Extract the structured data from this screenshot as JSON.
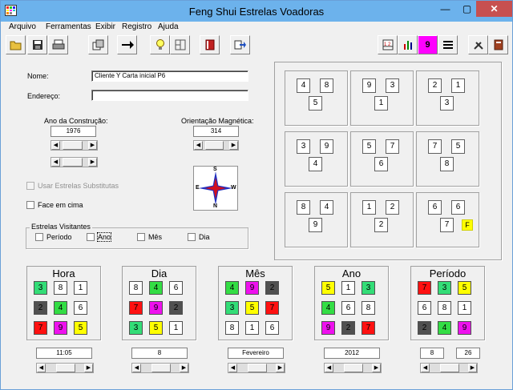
{
  "window": {
    "title": "Feng Shui Estrelas Voadoras",
    "minimize": "—",
    "maximize": "▢",
    "close": "✕"
  },
  "menu": [
    {
      "label": "Arquivo"
    },
    {
      "label": "Ferramentas"
    },
    {
      "label": "Exibir"
    },
    {
      "label": "Registro"
    },
    {
      "label": "Ajuda"
    }
  ],
  "toolbar": {
    "open": "open-folder-icon",
    "save": "save-disk-icon",
    "print": "printer-icon",
    "copy": "copy-icon",
    "next": "right-arrow-icon",
    "idea": "lightbulb-icon",
    "layout": "layout-icon",
    "book": "book-icon",
    "export": "export-icon",
    "right_tools": [
      "grid-numbers-icon",
      "bars-icon",
      "nine-icon",
      "lines-icon",
      "tools-icon",
      "manual-icon"
    ]
  },
  "form": {
    "nome_label": "Nome:",
    "nome_value": "Cliente Y  Carta inicial P6",
    "endereco_label": "Endereço:",
    "endereco_value": "",
    "ano_label": "Ano da Construção:",
    "ano_value": "1976",
    "orientacao_label": "Orientação Magnética:",
    "orientacao_value": "314",
    "usar_substitutas": "Usar Estrelas Substitutas",
    "face_em_cima": "Face em cima",
    "visitantes_title": "Estrelas Visitantes",
    "visitantes": [
      "Período",
      "Ano",
      "Mês",
      "Dia"
    ]
  },
  "compass": {
    "n": "N",
    "s": "S",
    "e": "E",
    "w": "W"
  },
  "palaces": [
    {
      "tl": "4",
      "tr": "8",
      "c": "5"
    },
    {
      "tl": "9",
      "tr": "3",
      "c": "1"
    },
    {
      "tl": "2",
      "tr": "1",
      "c": "3"
    },
    {
      "tl": "3",
      "tr": "9",
      "c": "4"
    },
    {
      "tl": "5",
      "tr": "7",
      "c": "6"
    },
    {
      "tl": "7",
      "tr": "5",
      "c": "8"
    },
    {
      "tl": "8",
      "tr": "4",
      "c": "9"
    },
    {
      "tl": "1",
      "tr": "2",
      "c": "2"
    },
    {
      "tl": "6",
      "tr": "6",
      "c": "7",
      "extra": "F"
    }
  ],
  "panels": [
    {
      "title": "Hora",
      "value": "11:05",
      "cells": [
        [
          "3",
          "#33dd77"
        ],
        [
          "8",
          "#ffffff"
        ],
        [
          "1",
          "#ffffff"
        ],
        [
          "2",
          "#505050"
        ],
        [
          "4",
          "#33dd44"
        ],
        [
          "6",
          "#ffffff"
        ],
        [
          "7",
          "#ff1111"
        ],
        [
          "9",
          "#ee11ee"
        ],
        [
          "5",
          "#ffff00"
        ]
      ]
    },
    {
      "title": "Dia",
      "value": "8",
      "cells": [
        [
          "8",
          "#ffffff"
        ],
        [
          "4",
          "#33dd44"
        ],
        [
          "6",
          "#ffffff"
        ],
        [
          "7",
          "#ff1111"
        ],
        [
          "9",
          "#ee11ee"
        ],
        [
          "2",
          "#505050"
        ],
        [
          "3",
          "#33dd77"
        ],
        [
          "5",
          "#ffff00"
        ],
        [
          "1",
          "#ffffff"
        ]
      ]
    },
    {
      "title": "Mês",
      "value": "Fevereiro",
      "cells": [
        [
          "4",
          "#33dd44"
        ],
        [
          "9",
          "#ee11ee"
        ],
        [
          "2",
          "#505050"
        ],
        [
          "3",
          "#33dd77"
        ],
        [
          "5",
          "#ffff00"
        ],
        [
          "7",
          "#ff1111"
        ],
        [
          "8",
          "#ffffff"
        ],
        [
          "1",
          "#ffffff"
        ],
        [
          "6",
          "#ffffff"
        ]
      ]
    },
    {
      "title": "Ano",
      "value": "2012",
      "cells": [
        [
          "5",
          "#ffff00"
        ],
        [
          "1",
          "#ffffff"
        ],
        [
          "3",
          "#33dd77"
        ],
        [
          "4",
          "#33dd44"
        ],
        [
          "6",
          "#ffffff"
        ],
        [
          "8",
          "#ffffff"
        ],
        [
          "9",
          "#ee11ee"
        ],
        [
          "2",
          "#505050"
        ],
        [
          "7",
          "#ff1111"
        ]
      ]
    },
    {
      "title": "Período",
      "value": "8",
      "value2": "26",
      "cells": [
        [
          "7",
          "#ff1111"
        ],
        [
          "3",
          "#33dd77"
        ],
        [
          "5",
          "#ffff00"
        ],
        [
          "6",
          "#ffffff"
        ],
        [
          "8",
          "#ffffff"
        ],
        [
          "1",
          "#ffffff"
        ],
        [
          "2",
          "#505050"
        ],
        [
          "4",
          "#33dd44"
        ],
        [
          "9",
          "#ee11ee"
        ]
      ]
    }
  ]
}
